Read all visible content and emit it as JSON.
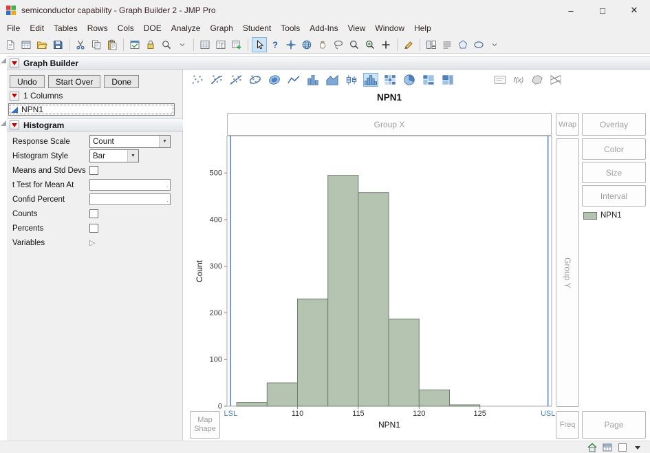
{
  "window": {
    "title": "semiconductor capability - Graph Builder 2 - JMP Pro",
    "controls": {
      "minimize": "–",
      "maximize": "□",
      "close": "✕"
    }
  },
  "menu_bar": {
    "items": [
      "File",
      "Edit",
      "Tables",
      "Rows",
      "Cols",
      "DOE",
      "Analyze",
      "Graph",
      "Student",
      "Tools",
      "Add-Ins",
      "View",
      "Window",
      "Help"
    ]
  },
  "toolbar": {
    "icons": [
      {
        "name": "new-journal-icon"
      },
      {
        "name": "new-data-table-icon"
      },
      {
        "name": "open-icon"
      },
      {
        "name": "save-icon"
      },
      {
        "separator": true
      },
      {
        "name": "cut-icon"
      },
      {
        "name": "copy-icon"
      },
      {
        "name": "paste-icon"
      },
      {
        "separator": true
      },
      {
        "name": "report-window-icon"
      },
      {
        "name": "lock-icon"
      },
      {
        "name": "search-icon"
      },
      {
        "name": "toolbar-overflow-icon"
      },
      {
        "separator": true
      },
      {
        "name": "data-grid-icon"
      },
      {
        "name": "summary-grid-icon"
      },
      {
        "name": "grid-plus-icon"
      },
      {
        "separator": true
      },
      {
        "name": "selection-arrow-tool-icon",
        "selected": true
      },
      {
        "name": "help-tool-icon"
      },
      {
        "name": "crosshair-tool-icon"
      },
      {
        "name": "globe-tool-icon"
      },
      {
        "name": "grabber-hand-tool-icon"
      },
      {
        "name": "lasso-tool-icon"
      },
      {
        "name": "magnifier-tool-icon"
      },
      {
        "name": "zoom-in-tool-icon"
      },
      {
        "name": "plus-tool-icon"
      },
      {
        "separator": true
      },
      {
        "name": "annotate-pencil-icon"
      },
      {
        "separator": true
      },
      {
        "name": "layout-boxes-icon"
      },
      {
        "name": "text-lines-icon"
      },
      {
        "name": "polygon-shape-icon"
      },
      {
        "name": "oval-shape-icon"
      },
      {
        "name": "toolbar-overflow-icon"
      }
    ]
  },
  "panel": {
    "header": {
      "title": "Graph Builder"
    },
    "buttons": [
      {
        "label": "Undo"
      },
      {
        "label": "Start Over"
      },
      {
        "label": "Done"
      }
    ],
    "columns_section": {
      "title": "1 Columns",
      "items": [
        {
          "name": "NPN1",
          "type": "continuous"
        }
      ]
    },
    "histogram_section": {
      "title": "Histogram",
      "rows": [
        {
          "label": "Response Scale",
          "control": "select",
          "value": "Count"
        },
        {
          "label": "Histogram Style",
          "control": "select",
          "value": "Bar"
        },
        {
          "label": "Means and Std Devs",
          "control": "checkbox",
          "checked": false
        },
        {
          "label": "t Test for Mean At",
          "control": "input",
          "value": ""
        },
        {
          "label": "Confid Percent",
          "control": "input",
          "value": ""
        },
        {
          "label": "Counts",
          "control": "checkbox",
          "checked": false
        },
        {
          "label": "Percents",
          "control": "checkbox",
          "checked": false
        },
        {
          "label": "Variables",
          "control": "disclosure"
        }
      ]
    }
  },
  "graph": {
    "element_icons": [
      {
        "name": "points-icon"
      },
      {
        "name": "smoother-icon"
      },
      {
        "name": "line-of-fit-icon"
      },
      {
        "name": "ellipse-icon"
      },
      {
        "name": "contour-icon"
      },
      {
        "name": "line-icon"
      },
      {
        "name": "bar-icon"
      },
      {
        "name": "area-icon"
      },
      {
        "name": "box-plot-icon"
      },
      {
        "name": "histogram-icon",
        "selected": true
      },
      {
        "name": "heatmap-icon"
      },
      {
        "name": "pie-icon"
      },
      {
        "name": "mosaic-icon"
      },
      {
        "name": "treemap-icon"
      },
      {
        "name": "caption-box-icon"
      },
      {
        "name": "formula-icon"
      },
      {
        "name": "map-shapes-icon"
      },
      {
        "name": "parallel-icon"
      }
    ],
    "title": "NPN1",
    "zones": {
      "group_x": "Group X",
      "wrap": "Wrap",
      "overlay": "Overlay",
      "color": "Color",
      "size": "Size",
      "interval": "Interval",
      "group_y": "Group Y",
      "map_shape": "Map Shape",
      "freq": "Freq",
      "page": "Page"
    },
    "legend": {
      "label": "NPN1",
      "swatch_color": "#b5c4b1"
    }
  },
  "chart_data": {
    "type": "bar",
    "title": "NPN1",
    "xlabel": "NPN1",
    "ylabel": "Count",
    "bin_width": 2.5,
    "bins": [
      {
        "start": 105,
        "count": 8
      },
      {
        "start": 107.5,
        "count": 50
      },
      {
        "start": 110,
        "count": 230
      },
      {
        "start": 112.5,
        "count": 495
      },
      {
        "start": 115,
        "count": 458
      },
      {
        "start": 117.5,
        "count": 187
      },
      {
        "start": 120,
        "count": 35
      },
      {
        "start": 122.5,
        "count": 3
      }
    ],
    "x_ticks": [
      110,
      115,
      120,
      125
    ],
    "y_ticks": [
      0,
      100,
      200,
      300,
      400,
      500
    ],
    "xlim": [
      104.2,
      130.9
    ],
    "ylim": [
      0,
      580
    ],
    "grid": false,
    "legend_position": "right",
    "reference_lines": [
      {
        "label": "LSL",
        "x": 104.5,
        "color": "#4d82bc"
      },
      {
        "label": "USL",
        "x": 130.6,
        "color": "#4d82bc"
      }
    ],
    "bar_fill": "#b5c4b1",
    "bar_stroke": "#6f7f6e"
  },
  "statusbar": {
    "icons": [
      {
        "name": "home-window-icon"
      },
      {
        "name": "data-table-status-icon"
      },
      {
        "name": "blank-window-icon"
      },
      {
        "name": "caret-down-icon"
      }
    ]
  },
  "colors": {
    "selection_highlight": "#cde4f7",
    "zone_text": "#9e9e9e",
    "spec_limit": "#4d82bc",
    "red_triangle": "#c40000"
  }
}
